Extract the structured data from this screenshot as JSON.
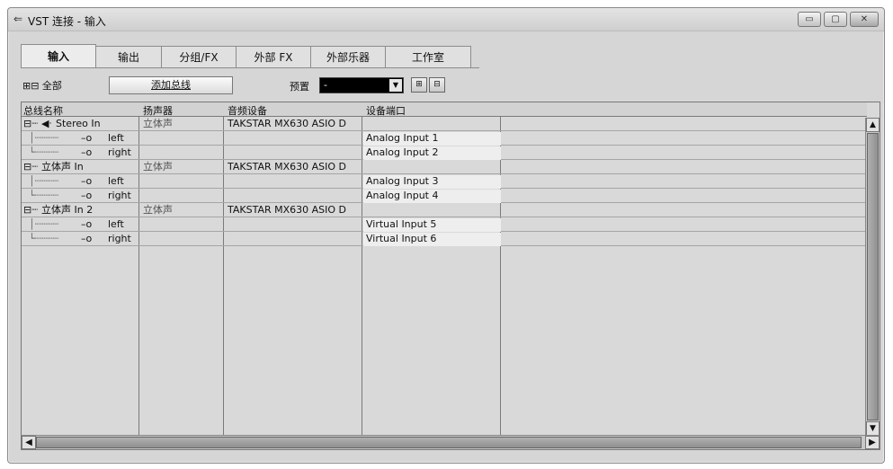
{
  "window": {
    "title": "VST 连接 - 输入",
    "buttons": {
      "minimize": "▭",
      "maximize": "▢",
      "close": "✕"
    }
  },
  "tabs": [
    {
      "label": "输入",
      "active": true
    },
    {
      "label": "输出",
      "active": false
    },
    {
      "label": "分组/FX",
      "active": false
    },
    {
      "label": "外部 FX",
      "active": false
    },
    {
      "label": "外部乐器",
      "active": false
    },
    {
      "label": "工作室",
      "active": false
    }
  ],
  "toolbar": {
    "expand_all": "⊞⊟ 全部",
    "add_bus": "添加总线",
    "preset_label": "预置",
    "preset_value": "-"
  },
  "columns": [
    "总线名称",
    "扬声器",
    "音频设备",
    "设备端口"
  ],
  "rows": [
    {
      "name": "Stereo In",
      "speaker": "立体声",
      "device": "TAKSTAR MX630 ASIO D",
      "port": ""
    },
    {
      "name": "left",
      "speaker": "",
      "device": "",
      "port": "Analog Input 1"
    },
    {
      "name": "right",
      "speaker": "",
      "device": "",
      "port": "Analog Input 2"
    },
    {
      "name": "立体声 In",
      "speaker": "立体声",
      "device": "TAKSTAR MX630 ASIO D",
      "port": ""
    },
    {
      "name": "left",
      "speaker": "",
      "device": "",
      "port": "Analog Input 3"
    },
    {
      "name": "right",
      "speaker": "",
      "device": "",
      "port": "Analog Input 4"
    },
    {
      "name": "立体声 In 2",
      "speaker": "立体声",
      "device": "TAKSTAR MX630 ASIO D",
      "port": ""
    },
    {
      "name": "left",
      "speaker": "",
      "device": "",
      "port": "Virtual Input 5"
    },
    {
      "name": "right",
      "speaker": "",
      "device": "",
      "port": "Virtual Input 6"
    }
  ]
}
